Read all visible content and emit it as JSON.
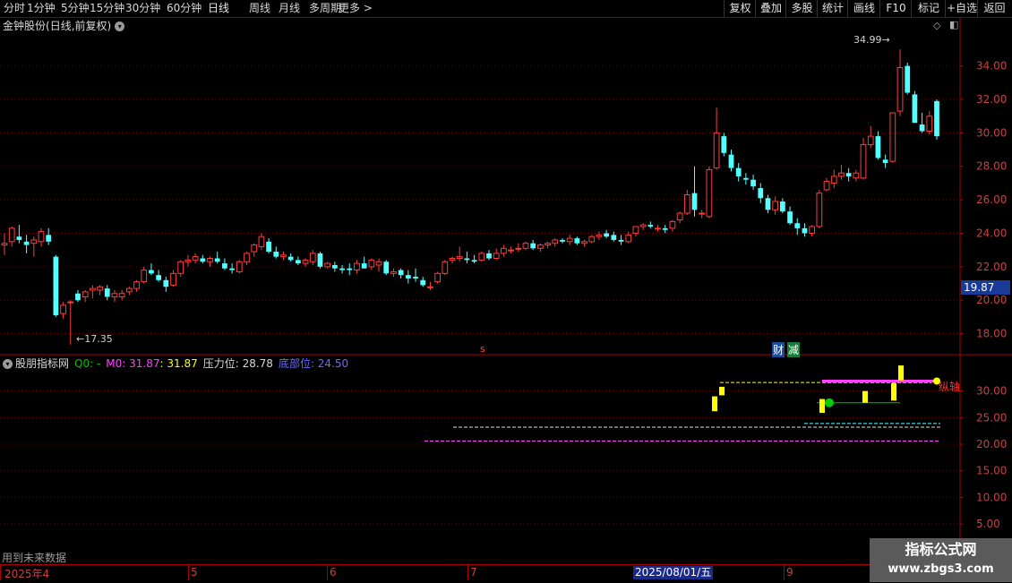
{
  "toolbar": {
    "timeframes": [
      "分时",
      "1分钟",
      "5分钟",
      "15分钟",
      "30分钟",
      "60分钟",
      "日线",
      "周线",
      "月线",
      "多周期",
      "更多 >"
    ],
    "active": "日线",
    "right_buttons": [
      "复权",
      "叠加",
      "多股",
      "统计",
      "画线",
      "F10",
      "标记",
      "+自选",
      "返回"
    ]
  },
  "header": {
    "stock_name": "金钟股份",
    "period_info": "(日线,前复权)"
  },
  "main_chart": {
    "y_ticks": [
      "34.00",
      "32.00",
      "30.00",
      "28.00",
      "26.00",
      "24.00",
      "22.00",
      "20.00",
      "18.00"
    ],
    "current_price": "19.87",
    "high_label": "34.99",
    "low_label": "17.35",
    "marker_s": "s",
    "tag_cai": "财",
    "tag_jian": "减"
  },
  "indicator": {
    "name": "股朋指标网",
    "q0": "Q0: -",
    "m0": "M0: 31.87",
    "val": ": 31.87",
    "pressure": "压力位: 28.78",
    "bottom": "底部位: 24.50",
    "y_ticks": [
      "30.00",
      "25.00",
      "20.00",
      "15.00",
      "10.00",
      "5.00"
    ],
    "zongzhou": "纵轴"
  },
  "bottom_note": "用到未来数据",
  "xaxis": {
    "labels": [
      "2025年4",
      "5",
      "6",
      "7",
      "9"
    ],
    "current_date": "2025/08/01/五"
  },
  "watermark": {
    "line1": "指标公式网",
    "line2": "www.zbgs3.com"
  },
  "colors": {
    "up": "#ff3c3c",
    "down": "#54ffff",
    "grid": "#6a0000",
    "axis": "#aa0000",
    "yellow": "#ffff00",
    "magenta": "#ff40ff"
  },
  "chart_data": {
    "type": "candlestick",
    "ylim": [
      16.8,
      35.8
    ],
    "candles": [
      [
        23.3,
        24.0,
        22.7,
        23.4
      ],
      [
        23.5,
        24.4,
        23.2,
        24.3
      ],
      [
        23.8,
        24.5,
        23.4,
        23.6
      ],
      [
        23.5,
        23.9,
        22.8,
        23.3
      ],
      [
        23.4,
        23.8,
        22.6,
        23.6
      ],
      [
        23.5,
        24.3,
        23.2,
        24.1
      ],
      [
        23.9,
        24.3,
        23.3,
        23.5
      ],
      [
        22.6,
        22.7,
        19.0,
        19.1
      ],
      [
        19.2,
        19.9,
        18.9,
        19.7
      ],
      [
        19.9,
        20.0,
        17.35,
        19.9
      ],
      [
        20.4,
        20.6,
        19.9,
        20.0
      ],
      [
        20.2,
        20.6,
        19.9,
        20.5
      ],
      [
        20.6,
        20.9,
        20.1,
        20.7
      ],
      [
        20.6,
        20.9,
        20.3,
        20.8
      ],
      [
        20.7,
        20.9,
        20.0,
        20.2
      ],
      [
        20.2,
        20.6,
        19.9,
        20.4
      ],
      [
        20.2,
        20.6,
        20.0,
        20.4
      ],
      [
        20.5,
        20.8,
        20.3,
        20.7
      ],
      [
        20.7,
        21.2,
        20.5,
        21.1
      ],
      [
        21.1,
        22.0,
        21.0,
        21.8
      ],
      [
        21.8,
        22.2,
        21.5,
        21.6
      ],
      [
        21.5,
        21.8,
        21.1,
        21.2
      ],
      [
        21.2,
        21.4,
        20.5,
        20.8
      ],
      [
        20.9,
        21.8,
        20.8,
        21.6
      ],
      [
        21.6,
        22.4,
        21.4,
        22.3
      ],
      [
        22.3,
        22.7,
        22.0,
        22.4
      ],
      [
        22.4,
        22.8,
        22.2,
        22.6
      ],
      [
        22.5,
        22.7,
        22.2,
        22.3
      ],
      [
        22.3,
        22.6,
        22.0,
        22.5
      ],
      [
        22.5,
        22.9,
        22.2,
        22.3
      ],
      [
        22.2,
        22.5,
        21.8,
        21.9
      ],
      [
        21.9,
        22.2,
        21.6,
        21.8
      ],
      [
        21.7,
        22.4,
        21.6,
        22.3
      ],
      [
        22.3,
        22.9,
        22.1,
        22.8
      ],
      [
        22.9,
        23.4,
        22.6,
        23.3
      ],
      [
        23.2,
        24.0,
        23.0,
        23.8
      ],
      [
        23.5,
        23.7,
        22.8,
        22.9
      ],
      [
        22.9,
        23.2,
        22.5,
        22.6
      ],
      [
        22.6,
        22.9,
        22.4,
        22.7
      ],
      [
        22.6,
        22.8,
        22.3,
        22.4
      ],
      [
        22.4,
        22.6,
        22.1,
        22.2
      ],
      [
        22.2,
        22.5,
        22.0,
        22.4
      ],
      [
        22.3,
        23.0,
        22.1,
        22.8
      ],
      [
        22.8,
        22.9,
        21.9,
        22.0
      ],
      [
        22.0,
        22.3,
        21.9,
        22.2
      ],
      [
        22.1,
        22.3,
        21.7,
        21.9
      ],
      [
        21.9,
        22.1,
        21.6,
        21.8
      ],
      [
        21.9,
        22.2,
        21.5,
        21.8
      ],
      [
        21.8,
        22.4,
        21.6,
        22.2
      ],
      [
        22.2,
        22.6,
        21.9,
        21.9
      ],
      [
        22.0,
        22.5,
        21.8,
        22.4
      ],
      [
        22.1,
        22.5,
        21.7,
        22.3
      ],
      [
        22.3,
        22.4,
        21.5,
        21.6
      ],
      [
        21.6,
        21.9,
        21.4,
        21.7
      ],
      [
        21.8,
        21.9,
        21.3,
        21.5
      ],
      [
        21.5,
        21.8,
        21.0,
        21.3
      ],
      [
        21.4,
        21.9,
        21.1,
        21.3
      ],
      [
        21.2,
        21.4,
        20.8,
        20.9
      ],
      [
        20.8,
        21.1,
        20.6,
        20.8
      ],
      [
        21.1,
        21.7,
        21.0,
        21.6
      ],
      [
        21.6,
        22.4,
        21.5,
        22.3
      ],
      [
        22.4,
        22.6,
        22.2,
        22.5
      ],
      [
        22.5,
        23.2,
        22.3,
        22.6
      ],
      [
        22.5,
        22.9,
        22.2,
        22.4
      ],
      [
        22.4,
        22.7,
        22.2,
        22.3
      ],
      [
        22.4,
        22.9,
        22.3,
        22.8
      ],
      [
        22.8,
        23.0,
        22.4,
        22.5
      ],
      [
        22.5,
        23.1,
        22.4,
        22.8
      ],
      [
        22.8,
        23.3,
        22.6,
        23.1
      ],
      [
        23.0,
        23.2,
        22.8,
        23.0
      ],
      [
        23.1,
        23.4,
        22.9,
        23.1
      ],
      [
        23.1,
        23.5,
        23.0,
        23.4
      ],
      [
        23.4,
        23.6,
        23.0,
        23.1
      ],
      [
        23.1,
        23.4,
        22.9,
        23.3
      ],
      [
        23.3,
        23.5,
        23.1,
        23.4
      ],
      [
        23.4,
        23.7,
        23.2,
        23.6
      ],
      [
        23.6,
        23.7,
        23.4,
        23.5
      ],
      [
        23.5,
        23.9,
        23.3,
        23.7
      ],
      [
        23.7,
        23.8,
        23.3,
        23.4
      ],
      [
        23.4,
        23.6,
        23.2,
        23.5
      ],
      [
        23.5,
        23.9,
        23.4,
        23.8
      ],
      [
        23.8,
        24.1,
        23.6,
        23.9
      ],
      [
        24.0,
        24.2,
        23.7,
        23.8
      ],
      [
        23.9,
        24.1,
        23.5,
        23.6
      ],
      [
        23.6,
        23.9,
        23.3,
        23.5
      ],
      [
        23.5,
        24.1,
        23.4,
        23.9
      ],
      [
        24.0,
        24.3,
        23.8,
        24.4
      ],
      [
        24.4,
        24.6,
        24.2,
        24.5
      ],
      [
        24.5,
        24.7,
        24.3,
        24.4
      ],
      [
        24.3,
        24.5,
        24.1,
        24.3
      ],
      [
        24.3,
        24.5,
        24.0,
        24.2
      ],
      [
        24.3,
        24.8,
        24.1,
        24.7
      ],
      [
        24.8,
        25.3,
        24.6,
        25.2
      ],
      [
        25.2,
        26.6,
        25.1,
        26.3
      ],
      [
        26.4,
        28.0,
        25.0,
        25.4
      ],
      [
        25.2,
        25.4,
        24.9,
        25.2
      ],
      [
        25.0,
        28.0,
        24.9,
        27.8
      ],
      [
        27.9,
        31.5,
        27.8,
        30.0
      ],
      [
        29.8,
        30.0,
        28.6,
        28.8
      ],
      [
        28.7,
        29.0,
        27.7,
        27.9
      ],
      [
        27.9,
        28.2,
        27.1,
        27.4
      ],
      [
        27.3,
        27.6,
        26.9,
        27.2
      ],
      [
        27.2,
        27.5,
        26.6,
        26.8
      ],
      [
        26.7,
        27.0,
        25.8,
        26.1
      ],
      [
        26.1,
        26.3,
        25.2,
        25.4
      ],
      [
        25.4,
        26.2,
        25.1,
        25.9
      ],
      [
        25.9,
        26.1,
        25.2,
        25.3
      ],
      [
        25.3,
        25.6,
        24.5,
        24.6
      ],
      [
        24.6,
        24.9,
        23.9,
        24.3
      ],
      [
        24.3,
        24.6,
        23.8,
        24.0
      ],
      [
        24.0,
        24.5,
        23.8,
        24.4
      ],
      [
        24.4,
        26.6,
        24.3,
        26.4
      ],
      [
        26.6,
        27.3,
        26.5,
        27.1
      ],
      [
        27.0,
        27.8,
        26.7,
        27.4
      ],
      [
        27.4,
        28.1,
        27.2,
        27.6
      ],
      [
        27.6,
        27.9,
        27.1,
        27.4
      ],
      [
        27.3,
        27.8,
        27.1,
        27.6
      ],
      [
        27.3,
        29.7,
        27.2,
        29.3
      ],
      [
        29.3,
        30.4,
        29.1,
        29.8
      ],
      [
        29.8,
        30.1,
        28.4,
        28.5
      ],
      [
        28.4,
        28.7,
        27.9,
        28.2
      ],
      [
        28.3,
        31.2,
        28.2,
        31.2
      ],
      [
        31.3,
        34.99,
        31.0,
        33.9
      ],
      [
        34.0,
        34.2,
        32.3,
        32.4
      ],
      [
        32.3,
        32.5,
        30.6,
        30.6
      ],
      [
        30.5,
        31.2,
        30.0,
        30.1
      ],
      [
        30.1,
        31.3,
        29.9,
        31.0
      ],
      [
        31.9,
        32.0,
        29.6,
        29.8
      ]
    ],
    "indicator_ylim": [
      2.5,
      36.5
    ],
    "pressure_level": 28.78,
    "bottom_level": 24.5,
    "m0": 31.87
  }
}
